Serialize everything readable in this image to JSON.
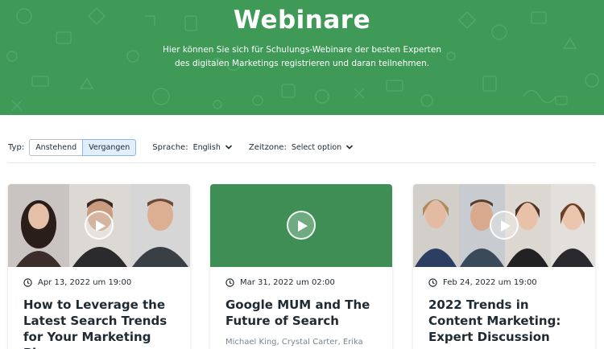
{
  "hero": {
    "title": "Webinare",
    "subtitle": "Hier können Sie sich für Schulungs-Webinare der besten Experten des digitalen Marketings registrieren und daran teilnehmen."
  },
  "filters": {
    "type_label": "Typ:",
    "type_options": [
      "Anstehend",
      "Vergangen"
    ],
    "type_selected": "Vergangen",
    "language_label": "Sprache:",
    "language_value": "English",
    "timezone_label": "Zeitzone:",
    "timezone_value": "Select option"
  },
  "cards": [
    {
      "date": "Apr 13, 2022 um 19:00",
      "title": "How to Leverage the Latest Search Trends for Your Marketing Plans",
      "speakers": "",
      "media": "speaker-photos"
    },
    {
      "date": "Mar 31, 2022 um 02:00",
      "title": "Google MUM and The Future of Search",
      "speakers": "Michael King, Crystal Carter, Erika",
      "media": "green-placeholder"
    },
    {
      "date": "Feb 24, 2022 um 19:00",
      "title": "2022 Trends in Content Marketing: Expert Discussion",
      "speakers": "",
      "media": "speaker-photos"
    }
  ],
  "colors": {
    "brand_green": "#3f9a58",
    "selected_bg": "#e1eefc",
    "selected_border": "#8ab6e8",
    "text_dark": "#1f2a33",
    "text_muted": "#7b858d"
  },
  "icons": [
    "chevron-down-icon",
    "clock-icon",
    "play-icon"
  ]
}
